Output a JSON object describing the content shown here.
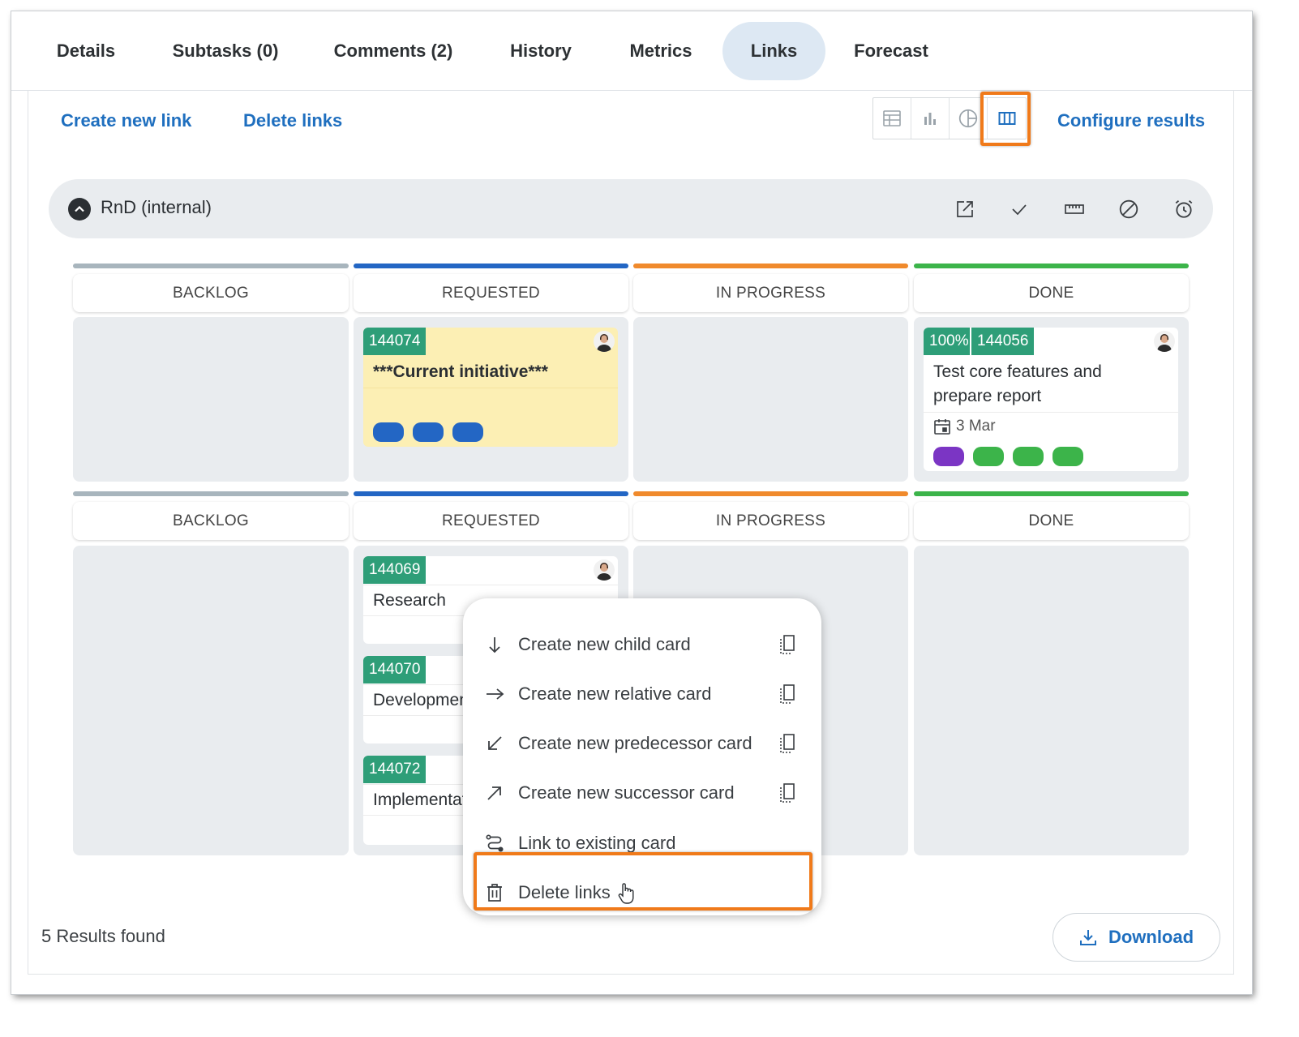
{
  "tabs": [
    {
      "label": "Details"
    },
    {
      "label": "Subtasks (0)"
    },
    {
      "label": "Comments (2)"
    },
    {
      "label": "History"
    },
    {
      "label": "Metrics"
    },
    {
      "label": "Links",
      "active": true
    },
    {
      "label": "Forecast"
    }
  ],
  "toolbar": {
    "create_link": "Create new link",
    "delete_links": "Delete links",
    "configure_results": "Configure results",
    "view_icons": [
      "table-view-icon",
      "bar-chart-view-icon",
      "pie-chart-view-icon",
      "board-view-icon"
    ],
    "active_view": "board-view-icon"
  },
  "group": {
    "title": "RnD (internal)",
    "actions": [
      "open-external-icon",
      "check-icon",
      "ruler-icon",
      "block-icon",
      "alarm-icon"
    ]
  },
  "columns": [
    {
      "label": "BACKLOG",
      "color": "#a8b5bd"
    },
    {
      "label": "REQUESTED",
      "color": "#2366c4"
    },
    {
      "label": "IN PROGRESS",
      "color": "#f08a2c"
    },
    {
      "label": "DONE",
      "color": "#3cb44a"
    }
  ],
  "lanes": [
    {
      "cards": [
        {
          "id": "144074",
          "title": "***Current initiative***",
          "column": "REQUESTED",
          "pills": [
            "#2366c4",
            "#2366c4",
            "#2366c4"
          ]
        },
        {
          "progress": "100%",
          "id": "144056",
          "title_line1": "Test core features and",
          "title_line2": "prepare report",
          "date": "3 Mar",
          "column": "DONE",
          "pills": [
            "#7b35c4",
            "#3cb44a",
            "#3cb44a",
            "#3cb44a"
          ]
        }
      ]
    },
    {
      "cards": [
        {
          "id": "144069",
          "title": "Research",
          "column": "REQUESTED"
        },
        {
          "id": "144070",
          "title": "Development",
          "column": "REQUESTED"
        },
        {
          "id": "144072",
          "title": "Implementation",
          "column": "REQUESTED"
        }
      ]
    }
  ],
  "context_menu": {
    "items": [
      {
        "label": "Create new child card",
        "icon": "arrow-down-icon"
      },
      {
        "label": "Create new relative card",
        "icon": "arrow-right-icon"
      },
      {
        "label": "Create new predecessor card",
        "icon": "arrow-down-left-icon"
      },
      {
        "label": "Create new successor card",
        "icon": "arrow-up-right-icon"
      },
      {
        "label": "Link to existing card",
        "icon": "route-icon"
      },
      {
        "label": "Delete links",
        "icon": "trash-icon",
        "highlighted": true
      }
    ]
  },
  "footer": {
    "results": "5 Results found",
    "download": "Download"
  },
  "colors": {
    "accent": "#1f6fbf",
    "highlight": "#f07a1a",
    "tag": "#2e9e78"
  }
}
